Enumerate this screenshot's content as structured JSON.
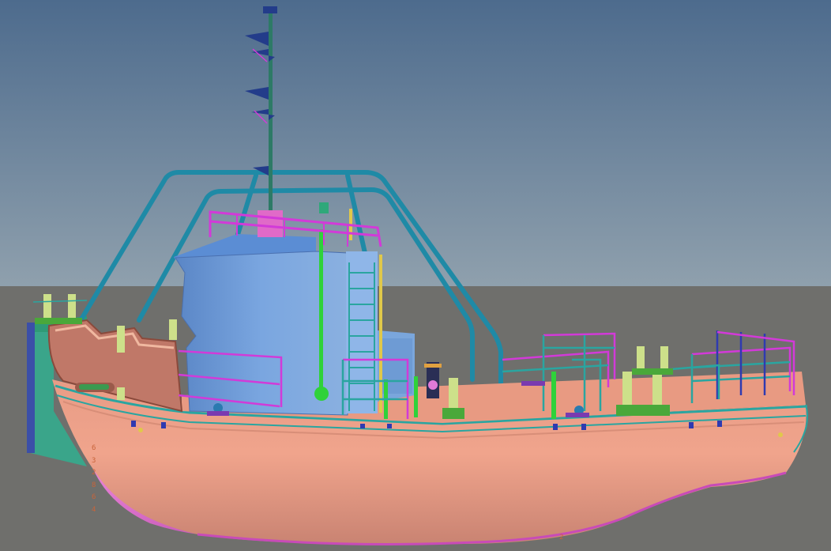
{
  "viewport": {
    "sky_top_color": "#4d6b8d",
    "sky_bottom_color": "#8fa0ad",
    "ground_color": "#6f6f6c"
  },
  "vessel": {
    "hull_color": "#f0a48c",
    "hull_shade_color": "#d88e78",
    "bulb_color": "#e070c8",
    "superstructure_color": "#6f9bd8",
    "gantry_color": "#1f8aa6",
    "railing_color": "#d23ad8",
    "equipment_color": "#8fcf55",
    "icons": [
      "mast-icon",
      "gantry-icon",
      "wheelhouse-icon",
      "bollard-icon",
      "winch-icon",
      "railing-icon",
      "ladder-icon"
    ]
  },
  "draft_marks": {
    "left": [
      "6",
      "3",
      "2",
      "8",
      "6",
      "4"
    ],
    "stern": "2"
  }
}
